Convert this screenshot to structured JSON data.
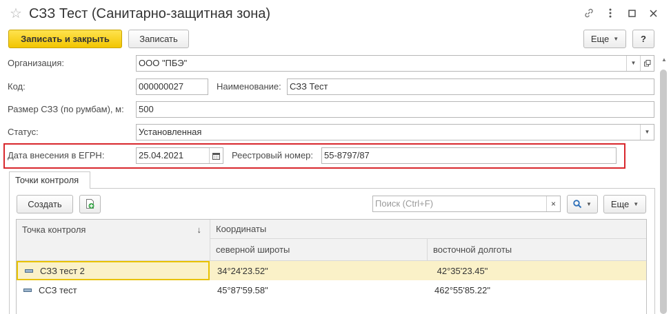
{
  "window": {
    "title": "СЗЗ Тест (Санитарно-защитная зона)",
    "star_icon": "☆",
    "link_icon": "🔗",
    "menu_icon": "⋮",
    "maximize_icon": "□",
    "close_icon": "✕"
  },
  "toolbar": {
    "save_close_label": "Записать и закрыть",
    "save_label": "Записать",
    "more_label": "Еще",
    "help_label": "?"
  },
  "form": {
    "org_label": "Организация:",
    "org_value": "ООО \"ПБЭ\"",
    "code_label": "Код:",
    "code_value": "000000027",
    "name_label": "Наименование:",
    "name_value": "СЗЗ Тест",
    "size_label": "Размер СЗЗ (по румбам), м:",
    "size_value": "500",
    "status_label": "Статус:",
    "status_value": "Установленная",
    "egrn_date_label": "Дата внесения в ЕГРН:",
    "egrn_date_value": "25.04.2021",
    "reg_num_label": "Реестровый номер:",
    "reg_num_value": "55-8797/87"
  },
  "tabs": [
    {
      "label": "Точки контроля"
    }
  ],
  "table_toolbar": {
    "create_label": "Создать",
    "search_placeholder": "Поиск (Ctrl+F)",
    "more_label": "Еще"
  },
  "table": {
    "col_point": "Точка контроля",
    "sort_indicator": "↓",
    "col_coords": "Координаты",
    "col_lat": "северной широты",
    "col_lon": "восточной долготы",
    "rows": [
      {
        "name": "СЗЗ тест 2",
        "lat": "34°24'23.52\"",
        "lon": " 42°35'23.45\""
      },
      {
        "name": "ССЗ тест",
        "lat": "45°87'59.58\"",
        "lon": "462°55'85.22\""
      }
    ]
  },
  "colors": {
    "accent_yellow": "#f2c500",
    "highlight_red": "#d8262b",
    "selected_row": "#faf1c8"
  }
}
